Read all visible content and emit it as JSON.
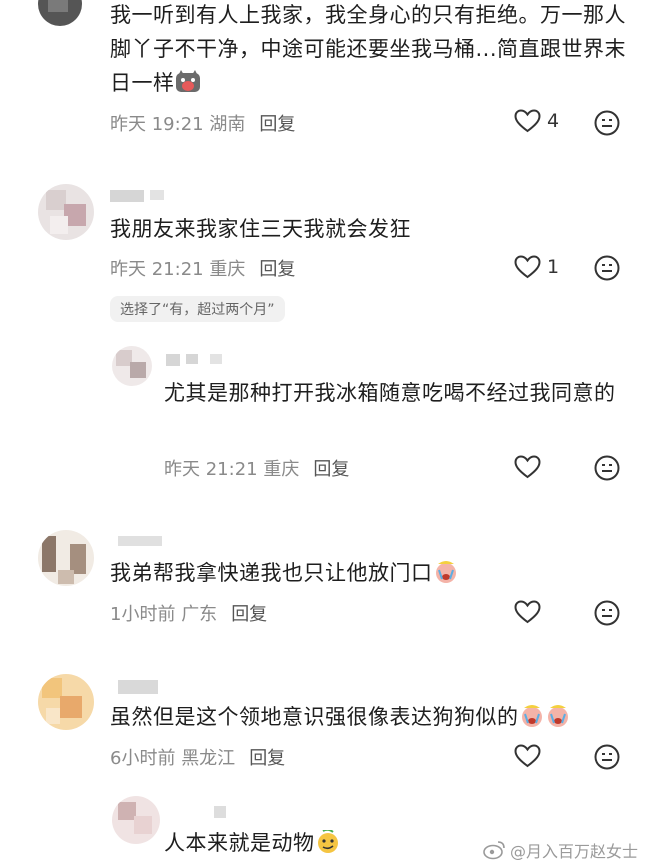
{
  "comments": [
    {
      "text": "我一听到有人上我家，我全身心的只有拒绝。万一那人脚丫子不干净，中途可能还要坐我马桶...简直跟世界末日一样",
      "time": "昨天 19:21",
      "location": "湖南",
      "reply_label": "回复",
      "likes": "4"
    },
    {
      "text": "我朋友来我家住三天我就会发狂",
      "time": "昨天 21:21",
      "location": "重庆",
      "reply_label": "回复",
      "likes": "1",
      "poll_chip": "选择了“有，超过两个月”"
    },
    {
      "text": "尤其是那种打开我冰箱随意吃喝不经过我同意的",
      "time": "昨天 21:21",
      "location": "重庆",
      "reply_label": "回复",
      "likes": ""
    },
    {
      "text": "我弟帮我拿快递我也只让他放门口",
      "time": "1小时前",
      "location": "广东",
      "reply_label": "回复",
      "likes": ""
    },
    {
      "text": "虽然但是这个领地意识强很像表达狗狗似的",
      "time": "6小时前",
      "location": "黑龙江",
      "reply_label": "回复",
      "likes": ""
    },
    {
      "text": "人本来就是动物",
      "time": "",
      "location": "",
      "reply_label": "",
      "likes": ""
    }
  ],
  "watermark": "@月入百万赵女士",
  "icons": {
    "like": "heart-outline-icon",
    "emoji": "emoji-face-icon"
  }
}
